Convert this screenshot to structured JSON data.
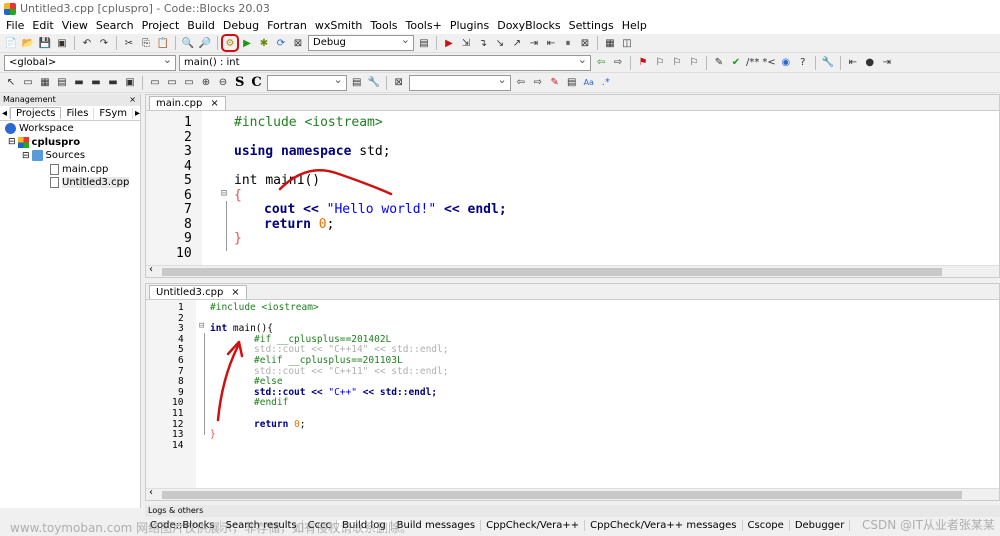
{
  "window": {
    "title": "Untitled3.cpp [cpluspro] - Code::Blocks 20.03"
  },
  "menu": [
    "File",
    "Edit",
    "View",
    "Search",
    "Project",
    "Build",
    "Debug",
    "Fortran",
    "wxSmith",
    "Tools",
    "Tools+",
    "Plugins",
    "DoxyBlocks",
    "Settings",
    "Help"
  ],
  "toolbar": {
    "build_target": "Debug",
    "scope_combo": "<global>",
    "function_combo": "main() : int",
    "s_label": "S",
    "c_label": "C",
    "comment_label": "/**",
    "star_label": "*<",
    "regex_label": ".*"
  },
  "management": {
    "title": "Management",
    "close": "×",
    "tabs": [
      "Projects",
      "Files",
      "FSym"
    ],
    "tree": {
      "workspace": "Workspace",
      "project": "cpluspro",
      "folder": "Sources",
      "files": [
        "main.cpp",
        "Untitled3.cpp"
      ]
    }
  },
  "editor1": {
    "tab": "main.cpp",
    "close": "×",
    "line_numbers": [
      "1",
      "2",
      "3",
      "4",
      "5",
      "6",
      "7",
      "8",
      "9",
      "10"
    ],
    "lines": {
      "l1": "#include <iostream>",
      "l3_kw1": "using",
      "l3_kw2": "namespace",
      "l3_rest": "std;",
      "l5_kw": "int",
      "l5_rest": "main1()",
      "l6": "{",
      "l7_a": "cout << ",
      "l7_str": "\"Hello world!\"",
      "l7_b": " << endl;",
      "l8_kw": "return",
      "l8_num": "0",
      "l8_end": ";",
      "l9": "}"
    }
  },
  "editor2": {
    "tab": "Untitled3.cpp",
    "close": "×",
    "line_numbers": [
      "1",
      "2",
      "3",
      "4",
      "5",
      "6",
      "7",
      "8",
      "9",
      "10",
      "11",
      "12",
      "13",
      "14"
    ],
    "lines": {
      "l1": "#include <iostream>",
      "l3_kw": "int",
      "l3_rest": "main(){",
      "l4": "#if __cplusplus==201402L",
      "l5": "std::cout << \"C++14\" << std::endl;",
      "l6": "#elif __cplusplus==201103L",
      "l7": "std::cout << \"C++11\" << std::endl;",
      "l8": "#else",
      "l9_a": "std::cout << ",
      "l9_str": "\"C++\"",
      "l9_b": " << std::endl;",
      "l10": "#endif",
      "l12_kw": "return",
      "l12_num": "0",
      "l12_end": ";",
      "l13": "}"
    }
  },
  "logs": {
    "title": "Logs & others",
    "tabs": [
      "Code::Blocks",
      "Search results",
      "Cccc",
      "Build log",
      "Build messages",
      "CppCheck/Vera++",
      "CppCheck/Vera++ messages",
      "Cscope",
      "Debugger"
    ]
  },
  "watermarks": {
    "left": "www.toymoban.com 网络图片仅供展示，非存储，如有侵权请联系删除。",
    "right": "CSDN @IT从业者张某某"
  },
  "colors": {
    "keyword": "#000080",
    "preprocessor": "#208020",
    "string": "#0000ff",
    "number": "#f07000",
    "annotation": "#d01010"
  }
}
